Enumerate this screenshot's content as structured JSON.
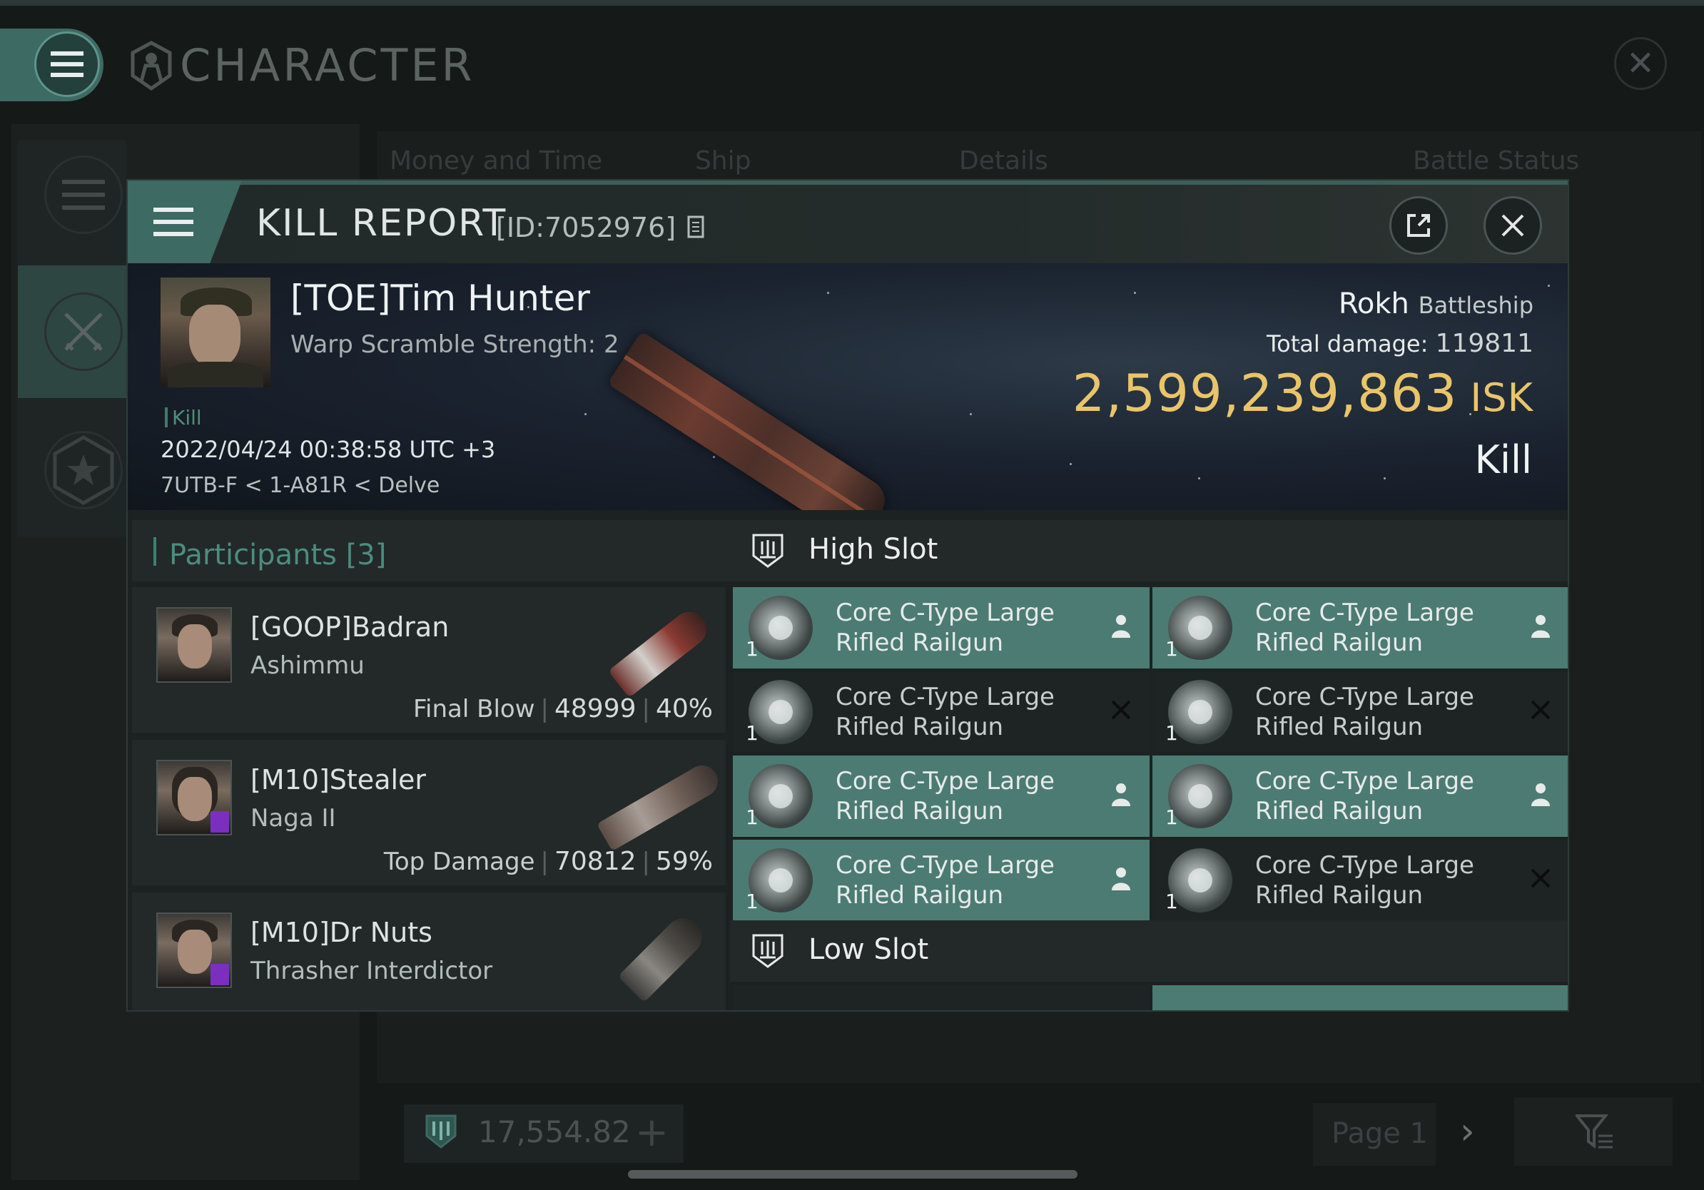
{
  "app": {
    "title": "CHARACTER",
    "tabs": [
      "Money and Time",
      "Ship",
      "Details",
      "Battle Status"
    ],
    "wallet": "17,554.82",
    "page": "Page 1"
  },
  "kill_report": {
    "title": "KILL REPORT",
    "id": "[ID:7052976]",
    "victim": {
      "name": "[TOE]Tim Hunter",
      "sub": "Warp Scramble Strength: 2",
      "kind": "Kill",
      "datetime": "2022/04/24 00:38:58 UTC +3",
      "location": "7UTB-F < 1-A81R < Delve",
      "ship": "Rokh",
      "ship_class": "Battleship",
      "total_damage_label": "Total damage:",
      "total_damage": "119811",
      "isk_value": "2,599,239,863",
      "isk_unit": "ISK",
      "status": "Kill"
    },
    "participants": {
      "title": "Participants",
      "count": "[3]",
      "items": [
        {
          "name": "[GOOP]Badran",
          "ship": "Ashimmu",
          "stat_label": "Final Blow",
          "damage": "48999",
          "percent": "40%"
        },
        {
          "name": "[M10]Stealer",
          "ship": "Naga II",
          "stat_label": "Top Damage",
          "damage": "70812",
          "percent": "59%"
        },
        {
          "name": "[M10]Dr Nuts",
          "ship": "Thrasher Interdictor"
        }
      ]
    },
    "high_slot": {
      "title": "High Slot",
      "modules": [
        {
          "line1": "Core C-Type Large",
          "line2": "Rifled Railgun",
          "qty": "1",
          "status": "person-icon"
        },
        {
          "line1": "Core C-Type Large",
          "line2": "Rifled Railgun",
          "qty": "1",
          "status": "person-icon"
        },
        {
          "line1": "Core C-Type Large",
          "line2": "Rifled Railgun",
          "qty": "1",
          "status": "x-icon"
        },
        {
          "line1": "Core C-Type Large",
          "line2": "Rifled Railgun",
          "qty": "1",
          "status": "x-icon"
        },
        {
          "line1": "Core C-Type Large",
          "line2": "Rifled Railgun",
          "qty": "1",
          "status": "person-icon"
        },
        {
          "line1": "Core C-Type Large",
          "line2": "Rifled Railgun",
          "qty": "1",
          "status": "person-icon"
        },
        {
          "line1": "Core C-Type Large",
          "line2": "Rifled Railgun",
          "qty": "1",
          "status": "person-icon"
        },
        {
          "line1": "Core C-Type Large",
          "line2": "Rifled Railgun",
          "qty": "1",
          "status": "x-icon"
        }
      ]
    },
    "low_slot": {
      "title": "Low Slot"
    }
  },
  "colors": {
    "accent": "#3d6a63",
    "module_dropped": "#4c7b73",
    "module_destroyed": "#1e2423",
    "isk": "#e9c56a"
  }
}
